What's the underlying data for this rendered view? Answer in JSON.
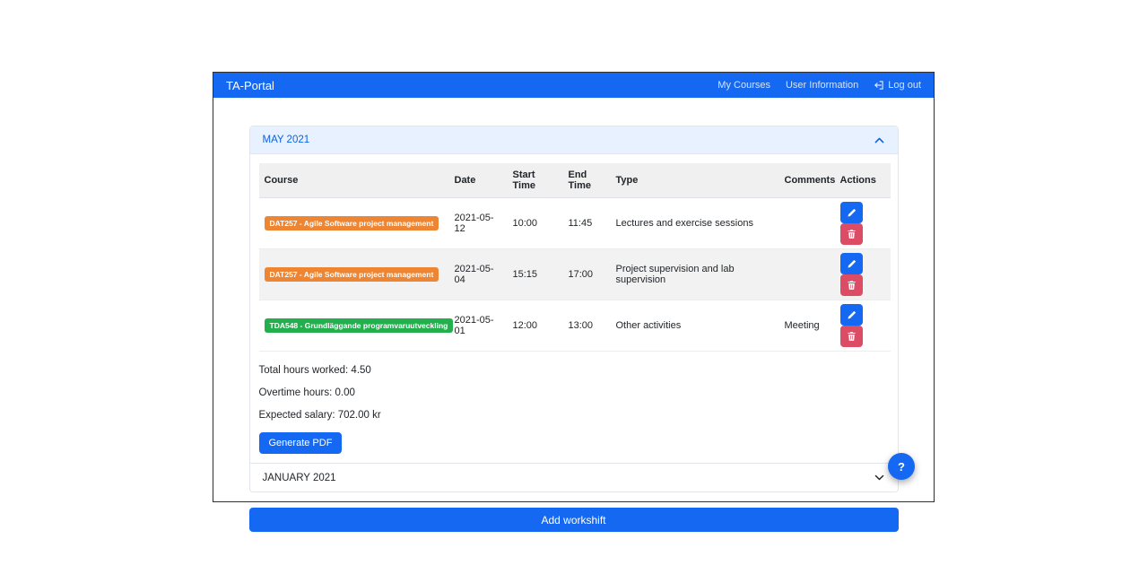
{
  "navbar": {
    "brand": "TA-Portal",
    "links": [
      {
        "label": "My Courses"
      },
      {
        "label": "User Information"
      },
      {
        "label": "Log out",
        "icon": "logout-icon"
      }
    ]
  },
  "accordion": [
    {
      "title": "MAY 2021",
      "expanded": true,
      "table": {
        "headers": [
          "Course",
          "Date",
          "Start Time",
          "End Time",
          "Type",
          "Comments",
          "Actions"
        ],
        "rows": [
          {
            "course": "DAT257 - Agile Software project management",
            "badge_color": "#ed8532",
            "date": "2021-05-12",
            "start": "10:00",
            "end": "11:45",
            "type": "Lectures and exercise sessions",
            "comments": ""
          },
          {
            "course": "DAT257 - Agile Software project management",
            "badge_color": "#ed8532",
            "date": "2021-05-04",
            "start": "15:15",
            "end": "17:00",
            "type": "Project supervision and lab supervision",
            "comments": ""
          },
          {
            "course": "TDA548 - Grundläggande programvaruutveckling",
            "badge_color": "#23af4e",
            "date": "2021-05-01",
            "start": "12:00",
            "end": "13:00",
            "type": "Other activities",
            "comments": "Meeting"
          }
        ]
      },
      "summary": [
        {
          "label": "Total hours worked:",
          "value": "4.50"
        },
        {
          "label": "Overtime hours:",
          "value": "0.00"
        },
        {
          "label": "Expected salary:",
          "value": "702.00 kr"
        }
      ],
      "generate_pdf_label": "Generate PDF"
    },
    {
      "title": "JANUARY 2021",
      "expanded": false
    }
  ],
  "add_workshift_label": "Add workshift",
  "help_label": "?",
  "icons": {
    "edit": "pencil-icon",
    "delete": "trash-icon",
    "expanded": "chevron-up-icon",
    "collapsed": "chevron-down-icon"
  },
  "colors": {
    "primary": "#1568f1",
    "danger": "#dc4c64",
    "badge_orange": "#ed8532",
    "badge_green": "#23af4e",
    "accordion_active_bg": "#e7f1ff",
    "accordion_active_text": "#0c63e4"
  }
}
